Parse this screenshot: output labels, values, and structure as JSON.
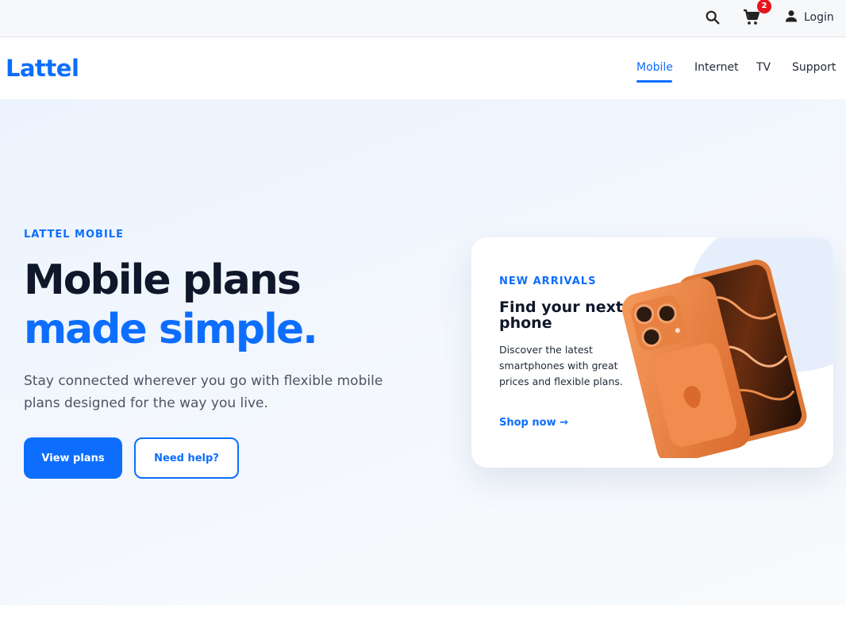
{
  "topbar": {
    "search_icon": "search-icon",
    "cart_icon": "cart-icon",
    "cart_count": "2",
    "user_icon": "user-icon",
    "login_label": "Login"
  },
  "brand": {
    "name": "Lattel",
    "color": "#0d6efd"
  },
  "nav": {
    "items": [
      {
        "label": "Mobile",
        "active": true
      },
      {
        "label": "Internet",
        "active": false
      },
      {
        "label": "TV",
        "active": false
      },
      {
        "label": "Support",
        "active": false
      }
    ]
  },
  "hero": {
    "eyebrow": "LATTEL MOBILE",
    "headline_line1": "Mobile plans",
    "headline_line2": "made simple.",
    "lead": "Stay connected wherever you go with flexible mobile plans designed for the way you live.",
    "primary_button": "View plans",
    "secondary_button": "Need help?"
  },
  "promo": {
    "eyebrow": "NEW ARRIVALS",
    "title": "Find your next phone",
    "description": "Discover the latest smartphones with great prices and flexible plans.",
    "link": "Shop now →",
    "image_icon": "smartphone-image"
  },
  "colors": {
    "accent": "#0d6efd",
    "heading": "#0f172a",
    "badge": "#e5141c",
    "phone_orange": "#f08a4b"
  }
}
